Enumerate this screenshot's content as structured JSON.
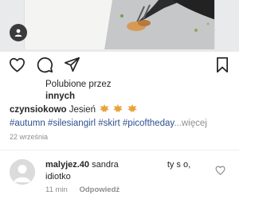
{
  "post": {
    "likes_prefix": "Polubione przez",
    "likes_suffix": "innych",
    "caption_user": "czynsiokowo",
    "caption_text": "Jesień",
    "hashtags": "#autumn #silesiangirl #skirt #picoftheday",
    "more": "...więcej",
    "date": "22 września"
  },
  "comment": {
    "user": "malyjez.40",
    "text_a": "sandra",
    "text_b": "ty s",
    "text_c": "o,",
    "text_d": "idiotko",
    "time": "11 min",
    "reply": "Odpowiedź"
  },
  "icons": {
    "actions": [
      "heart-icon",
      "comment-icon",
      "share-icon",
      "bookmark-icon"
    ],
    "photo_badge": "person-tag-icon",
    "caption_emoji": "maple-leaf-icon",
    "comment_like": "heart-outline-icon"
  },
  "colors": {
    "text": "#262626",
    "hashtag": "#2f4f8f",
    "secondary": "#8e8e8e",
    "leaf": "#e8a33d"
  }
}
